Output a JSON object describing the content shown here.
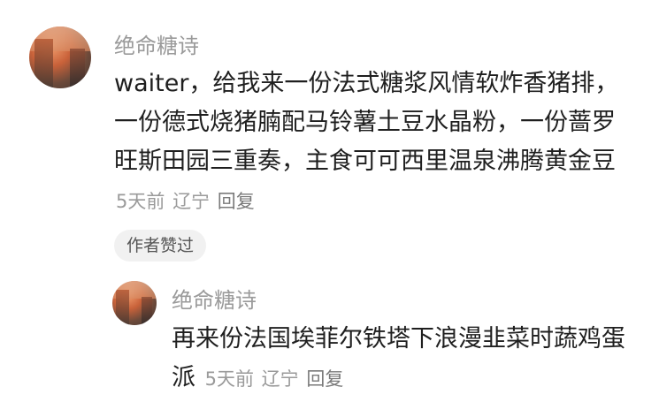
{
  "comment": {
    "username": "绝命糖诗",
    "text": "waiter，给我来一份法式糖浆风情软炸香猪排，一份德式烧猪腩配马铃薯土豆水晶粉，一份蔷罗旺斯田园三重奏，主食可可西里温泉沸腾黄金豆",
    "time": "5天前",
    "location": "辽宁",
    "reply_label": "回复",
    "author_liked_badge": "作者赞过"
  },
  "reply": {
    "username": "绝命糖诗",
    "text": "再来份法国埃菲尔铁塔下浪漫韭菜时蔬鸡蛋派",
    "time": "5天前",
    "location": "辽宁",
    "reply_label": "回复"
  }
}
